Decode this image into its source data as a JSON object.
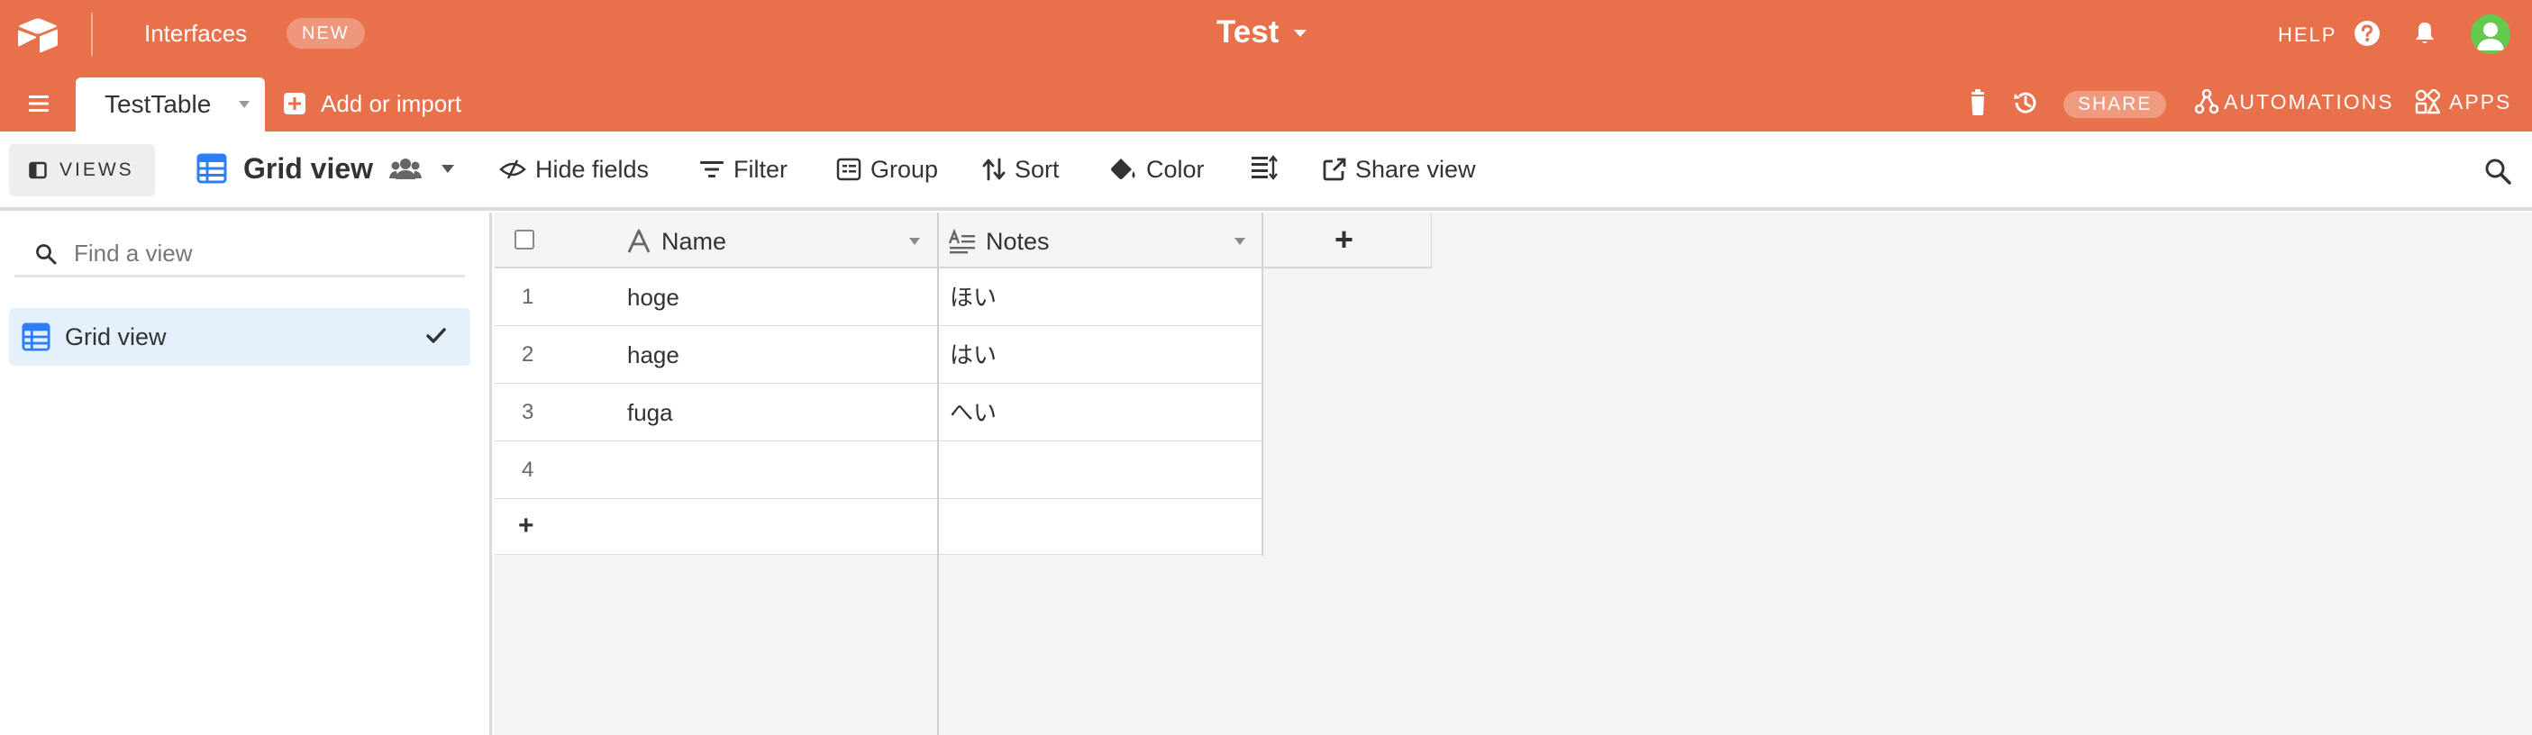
{
  "topbar": {
    "interfaces_label": "Interfaces",
    "new_badge": "NEW",
    "base_title": "Test",
    "help_label": "HELP",
    "brand_color": "#e8704a"
  },
  "tabs": {
    "table_tab": "TestTable",
    "add_import": "Add or import",
    "share": "SHARE",
    "automations": "AUTOMATIONS",
    "apps": "APPS"
  },
  "viewbar": {
    "views_label": "VIEWS",
    "view_name": "Grid view",
    "hide_fields": "Hide fields",
    "filter": "Filter",
    "group": "Group",
    "sort": "Sort",
    "color": "Color",
    "share_view": "Share view"
  },
  "sidebar": {
    "search_placeholder": "Find a view",
    "views": [
      {
        "label": "Grid view",
        "selected": true
      }
    ]
  },
  "grid": {
    "columns": [
      {
        "label": "Name",
        "icon": "text-a-icon"
      },
      {
        "label": "Notes",
        "icon": "long-text-icon"
      }
    ],
    "add_column": "+",
    "rows": [
      {
        "num": "1",
        "name": "hoge",
        "notes": "ほい"
      },
      {
        "num": "2",
        "name": "hage",
        "notes": "はい"
      },
      {
        "num": "3",
        "name": "fuga",
        "notes": "へい"
      },
      {
        "num": "4",
        "name": "",
        "notes": ""
      }
    ],
    "add_row": "+"
  }
}
